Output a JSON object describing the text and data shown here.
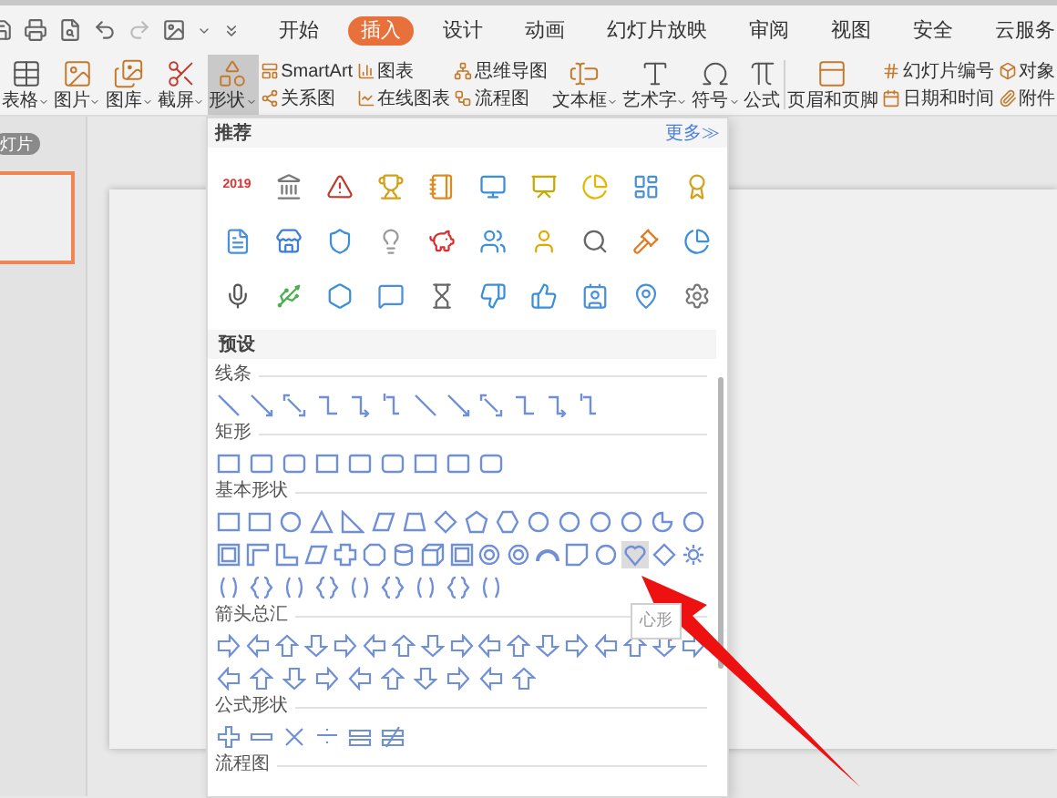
{
  "menu_tabs": [
    {
      "label": "开始",
      "selected": false
    },
    {
      "label": "插入",
      "selected": true
    },
    {
      "label": "设计",
      "selected": false
    },
    {
      "label": "动画",
      "selected": false
    },
    {
      "label": "幻灯片放映",
      "selected": false
    },
    {
      "label": "审阅",
      "selected": false
    },
    {
      "label": "视图",
      "selected": false
    },
    {
      "label": "安全",
      "selected": false
    },
    {
      "label": "云服务",
      "selected": false
    }
  ],
  "ribbon": [
    {
      "kind": "large",
      "label": "表格",
      "dropdown": true,
      "selected": false
    },
    {
      "kind": "large",
      "label": "图片",
      "dropdown": true,
      "selected": false
    },
    {
      "kind": "large",
      "label": "图库",
      "dropdown": true,
      "selected": false
    },
    {
      "kind": "large",
      "label": "截屏",
      "dropdown": true,
      "selected": false
    },
    {
      "kind": "large",
      "label": "形状",
      "dropdown": true,
      "selected": true
    },
    {
      "kind": "pair",
      "items": [
        {
          "label": "SmartArt"
        },
        {
          "label": "关系图"
        }
      ]
    },
    {
      "kind": "pair",
      "items": [
        {
          "label": "图表"
        },
        {
          "label": "在线图表"
        }
      ]
    },
    {
      "kind": "pair",
      "items": [
        {
          "label": "思维导图"
        },
        {
          "label": "流程图"
        }
      ]
    },
    {
      "kind": "large",
      "label": "文本框",
      "dropdown": true,
      "selected": false
    },
    {
      "kind": "large",
      "label": "艺术字",
      "dropdown": true,
      "selected": false
    },
    {
      "kind": "large",
      "label": "符号",
      "dropdown": true,
      "selected": false
    },
    {
      "kind": "large",
      "label": "公式",
      "dropdown": false,
      "selected": false
    },
    {
      "kind": "separator"
    },
    {
      "kind": "large",
      "label": "页眉和页脚",
      "dropdown": false,
      "selected": false
    },
    {
      "kind": "pair",
      "items": [
        {
          "label": "幻灯片编号"
        },
        {
          "label": "日期和时间"
        }
      ]
    },
    {
      "kind": "pair",
      "items": [
        {
          "label": "对象"
        },
        {
          "label": "附件"
        }
      ]
    }
  ],
  "slides_panel": {
    "tab": "灯片",
    "thumbnails": [
      {
        "selected": true
      }
    ]
  },
  "shapes_menu": {
    "recommended": {
      "title": "推荐",
      "more": "更多≫",
      "badge_text": "2019"
    },
    "presets": {
      "title": "预设",
      "sections": [
        {
          "title": "线条",
          "rows": [
            {
              "items": [
                {
                  "selected": false
                },
                {
                  "selected": false
                },
                {
                  "selected": false
                },
                {
                  "selected": false
                },
                {
                  "selected": false
                },
                {
                  "selected": false
                },
                {
                  "selected": false
                },
                {
                  "selected": false
                },
                {
                  "selected": false
                },
                {
                  "selected": false
                },
                {
                  "selected": false
                },
                {
                  "selected": false
                }
              ]
            }
          ]
        },
        {
          "title": "矩形",
          "rows": [
            {
              "items": [
                {
                  "selected": false
                },
                {
                  "selected": false
                },
                {
                  "selected": false
                },
                {
                  "selected": false
                },
                {
                  "selected": false
                },
                {
                  "selected": false
                },
                {
                  "selected": false
                },
                {
                  "selected": false
                },
                {
                  "selected": false
                }
              ]
            }
          ]
        },
        {
          "title": "基本形状",
          "rows": [
            {
              "items": [
                {
                  "selected": false
                },
                {
                  "selected": false
                },
                {
                  "selected": false
                },
                {
                  "selected": false
                },
                {
                  "selected": false
                },
                {
                  "selected": false
                },
                {
                  "selected": false
                },
                {
                  "selected": false
                },
                {
                  "selected": false
                },
                {
                  "selected": false
                },
                {
                  "selected": false
                },
                {
                  "selected": false
                },
                {
                  "selected": false
                },
                {
                  "selected": false
                },
                {
                  "selected": false
                },
                {
                  "selected": false
                }
              ]
            },
            {
              "items": [
                {
                  "selected": false
                },
                {
                  "selected": false
                },
                {
                  "selected": false
                },
                {
                  "selected": false
                },
                {
                  "selected": false
                },
                {
                  "selected": false
                },
                {
                  "selected": false
                },
                {
                  "selected": false
                },
                {
                  "selected": false
                },
                {
                  "selected": false
                },
                {
                  "selected": false
                },
                {
                  "selected": false
                },
                {
                  "selected": false
                },
                {
                  "selected": false
                },
                {
                  "selected": true
                },
                {
                  "selected": false
                },
                {
                  "selected": false
                }
              ]
            },
            {
              "items": [
                {
                  "selected": false
                },
                {
                  "selected": false
                },
                {
                  "selected": false
                },
                {
                  "selected": false
                },
                {
                  "selected": false
                },
                {
                  "selected": false
                },
                {
                  "selected": false
                },
                {
                  "selected": false
                },
                {
                  "selected": false
                }
              ]
            }
          ]
        },
        {
          "title": "箭头总汇",
          "rows": [
            {
              "items": [
                {
                  "selected": false
                },
                {
                  "selected": false
                },
                {
                  "selected": false
                },
                {
                  "selected": false
                },
                {
                  "selected": false
                },
                {
                  "selected": false
                },
                {
                  "selected": false
                },
                {
                  "selected": false
                },
                {
                  "selected": false
                },
                {
                  "selected": false
                },
                {
                  "selected": false
                },
                {
                  "selected": false
                },
                {
                  "selected": false
                },
                {
                  "selected": false
                },
                {
                  "selected": false
                },
                {
                  "selected": false
                },
                {
                  "selected": false
                }
              ]
            },
            {
              "items": [
                {
                  "selected": false
                },
                {
                  "selected": false
                },
                {
                  "selected": false
                },
                {
                  "selected": false
                },
                {
                  "selected": false
                },
                {
                  "selected": false
                },
                {
                  "selected": false
                },
                {
                  "selected": false
                },
                {
                  "selected": false
                },
                {
                  "selected": false
                }
              ]
            }
          ]
        },
        {
          "title": "公式形状",
          "rows": [
            {
              "items": [
                {
                  "selected": false
                },
                {
                  "selected": false
                },
                {
                  "selected": false
                },
                {
                  "selected": false
                },
                {
                  "selected": false
                },
                {
                  "selected": false
                }
              ]
            }
          ]
        },
        {
          "title": "流程图"
        }
      ]
    },
    "tooltip": "心形"
  }
}
